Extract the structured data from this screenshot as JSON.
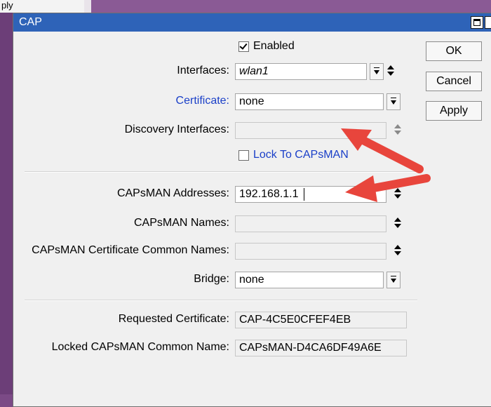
{
  "background": {
    "corner_button_label": "ply"
  },
  "window": {
    "title": "CAP",
    "close_glyph": "✕"
  },
  "fields": {
    "enabled": {
      "label": "Enabled",
      "checked": true
    },
    "interfaces": {
      "label": "Interfaces:",
      "value": "wlan1"
    },
    "certificate": {
      "label": "Certificate:",
      "value": "none"
    },
    "discovery_interfaces": {
      "label": "Discovery Interfaces:",
      "value": ""
    },
    "lock_to_capsman": {
      "label": "Lock To CAPsMAN",
      "checked": false
    },
    "capsman_addresses": {
      "label": "CAPsMAN Addresses:",
      "value": "192.168.1.1"
    },
    "capsman_names": {
      "label": "CAPsMAN Names:",
      "value": ""
    },
    "capsman_cert_common_names": {
      "label": "CAPsMAN Certificate Common Names:",
      "value": ""
    },
    "bridge": {
      "label": "Bridge:",
      "value": "none"
    },
    "requested_certificate": {
      "label": "Requested Certificate:",
      "value": "CAP-4C5E0CFEF4EB"
    },
    "locked_capsman_common_name": {
      "label": "Locked CAPsMAN Common Name:",
      "value": "CAPsMAN-D4CA6DF49A6E"
    }
  },
  "buttons": {
    "ok": "OK",
    "cancel": "Cancel",
    "apply": "Apply"
  },
  "colors": {
    "titlebar": "#2e63b8",
    "link_label": "#1a3fc8",
    "annotation_arrow": "#e8453c",
    "badge_fill": "#f5f000",
    "badge_border": "#1b9e3a"
  }
}
